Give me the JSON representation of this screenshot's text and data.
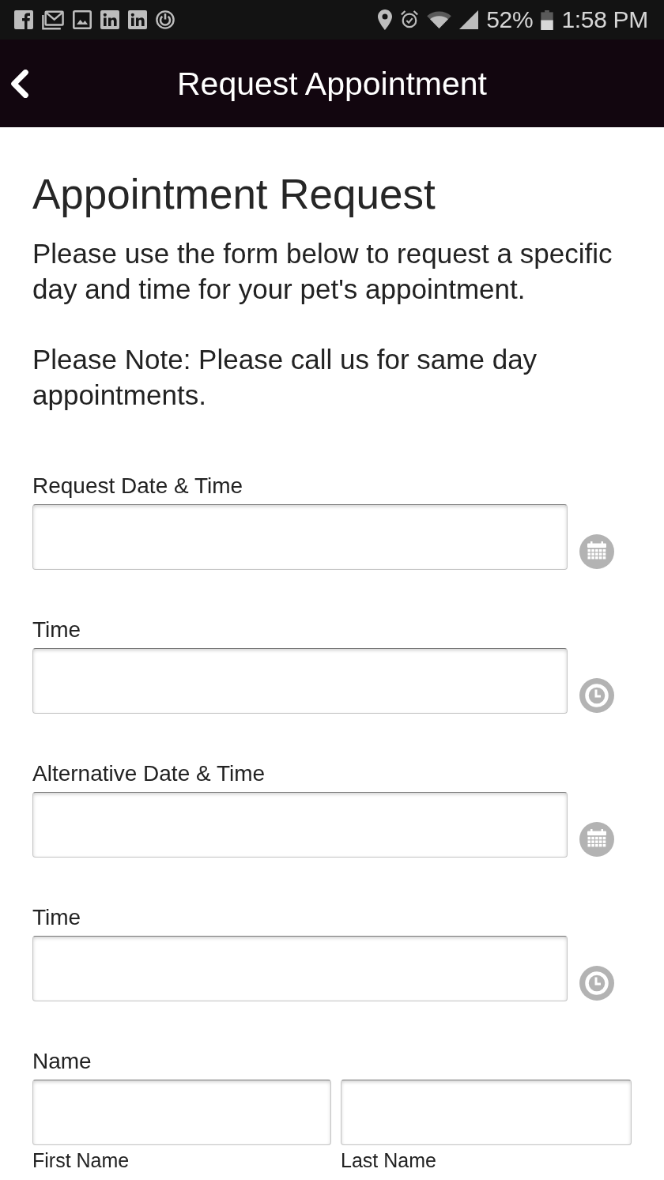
{
  "status_bar": {
    "battery": "52%",
    "time": "1:58 PM"
  },
  "header": {
    "title": "Request Appointment"
  },
  "form": {
    "heading": "Appointment Request",
    "intro": "Please use the form below to request a specific day and time for your pet's appointment.",
    "note": "Please Note: Please call us for same day appointments.",
    "fields": [
      {
        "label": "Request Date & Time",
        "kind": "date"
      },
      {
        "label": "Time",
        "kind": "time"
      },
      {
        "label": "Alternative Date & Time",
        "kind": "date"
      },
      {
        "label": "Time",
        "kind": "time"
      },
      {
        "label": "Name",
        "kind": "name",
        "parts": [
          "First Name",
          "Last Name"
        ]
      }
    ]
  }
}
